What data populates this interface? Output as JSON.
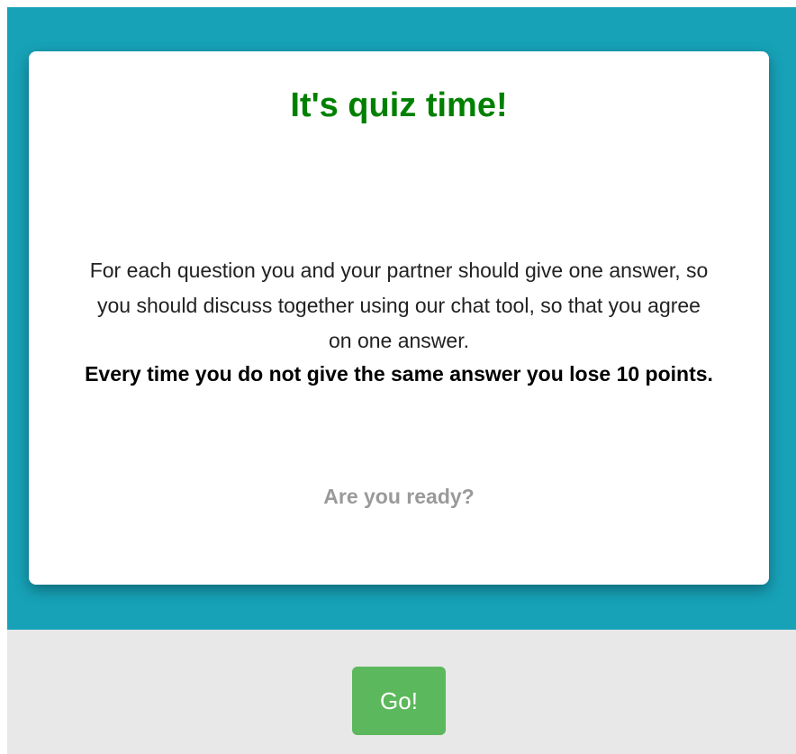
{
  "card": {
    "title": "It's quiz time!",
    "instructions": [
      "For each question you and your partner should give one answer, so",
      "you should discuss together using our chat tool, so that you agree",
      "on one answer."
    ],
    "warning": "Every time you do not give the same answer you lose 10 points.",
    "ready_prompt": "Are you ready?"
  },
  "footer": {
    "go_label": "Go!"
  },
  "colors": {
    "panel_background": "#17a2b8",
    "title": "#008000",
    "ready_prompt": "#9a9a9a",
    "go_button": "#5cb85c",
    "footer_background": "#e8e8e8"
  }
}
